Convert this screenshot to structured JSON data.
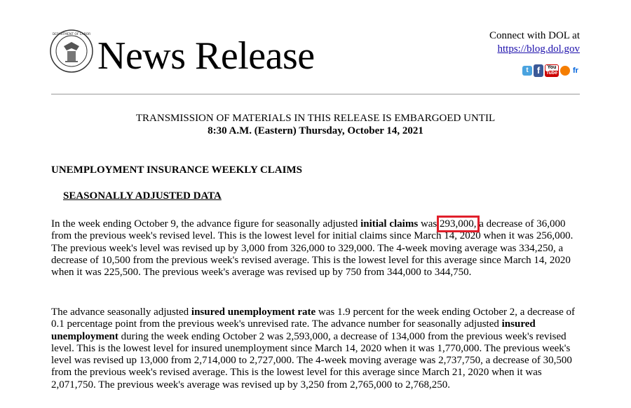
{
  "header": {
    "title": "News Release",
    "connect_text": "Connect with DOL at",
    "blog_link": "https://blog.dol.gov",
    "social_icons": [
      "twitter-icon",
      "facebook-icon",
      "youtube-icon",
      "blog-icon",
      "flickr-icon"
    ]
  },
  "embargo": {
    "line1": "TRANSMISSION OF MATERIALS IN THIS RELEASE IS EMBARGOED UNTIL",
    "line2": "8:30 A.M. (Eastern) Thursday, October 14, 2021"
  },
  "section_title": "UNEMPLOYMENT INSURANCE WEEKLY CLAIMS",
  "subsection_title": "SEASONALLY ADJUSTED DATA",
  "para1": {
    "a": "In the week ending October 9, the advance figure for seasonally adjusted ",
    "bold1": "initial claims",
    "b": " was ",
    "highlight": "293,000,",
    "c": " a decrease of 36,000 from the previous week's revised level. This is the lowest level for initial claims since March 14, 2020 when it was 256,000. The previous week's level was revised up by 3,000 from 326,000 to 329,000. The 4-week moving average was 334,250, a decrease of 10,500 from the previous week's revised average. This is the lowest level for this average since March 14, 2020 when it was 225,500. The previous week's average was revised up by 750 from 344,000 to 344,750."
  },
  "para2": {
    "a": "The advance seasonally adjusted ",
    "bold1": "insured unemployment rate",
    "b": " was 1.9 percent for the week ending October 2, a decrease of 0.1 percentage point from the previous week's unrevised rate. The advance number for seasonally adjusted ",
    "bold2": "insured unemployment",
    "c": " during the week ending October 2 was 2,593,000, a decrease of 134,000 from the previous week's revised level. This is the lowest level for insured unemployment since March 14, 2020 when it was 1,770,000. The previous week's level was revised up 13,000 from 2,714,000 to 2,727,000. The 4-week moving average was 2,737,750, a decrease of 30,500 from the previous week's revised average. This is the lowest level for this average since March 21, 2020 when it was 2,071,750. The previous week's average was revised up by 3,250 from 2,765,000 to 2,768,250."
  },
  "colors": {
    "highlight_box": "#e01f2b",
    "link": "#1a0dab"
  }
}
